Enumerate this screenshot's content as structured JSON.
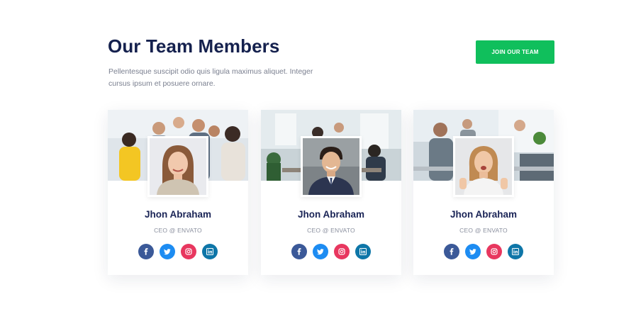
{
  "header": {
    "title": "Our Team Members",
    "description": "Pellentesque suscipit odio quis ligula maximus aliquet. Integer cursus ipsum et posuere ornare.",
    "join_button_label": "JOIN OUR TEAM"
  },
  "colors": {
    "accent_green": "#10bf5c",
    "heading_navy": "#15214e",
    "facebook": "#3b5998",
    "twitter": "#1d8cf2",
    "instagram": "#e8375f",
    "linkedin": "#0e76a8"
  },
  "team": [
    {
      "name": "Jhon Abraham",
      "role": "CEO @ ENVATO",
      "socials": [
        "facebook-icon",
        "twitter-icon",
        "instagram-icon",
        "linkedin-icon"
      ]
    },
    {
      "name": "Jhon Abraham",
      "role": "CEO @ ENVATO",
      "socials": [
        "facebook-icon",
        "twitter-icon",
        "instagram-icon",
        "linkedin-icon"
      ]
    },
    {
      "name": "Jhon Abraham",
      "role": "CEO @ ENVATO",
      "socials": [
        "facebook-icon",
        "twitter-icon",
        "instagram-icon",
        "linkedin-icon"
      ]
    }
  ]
}
